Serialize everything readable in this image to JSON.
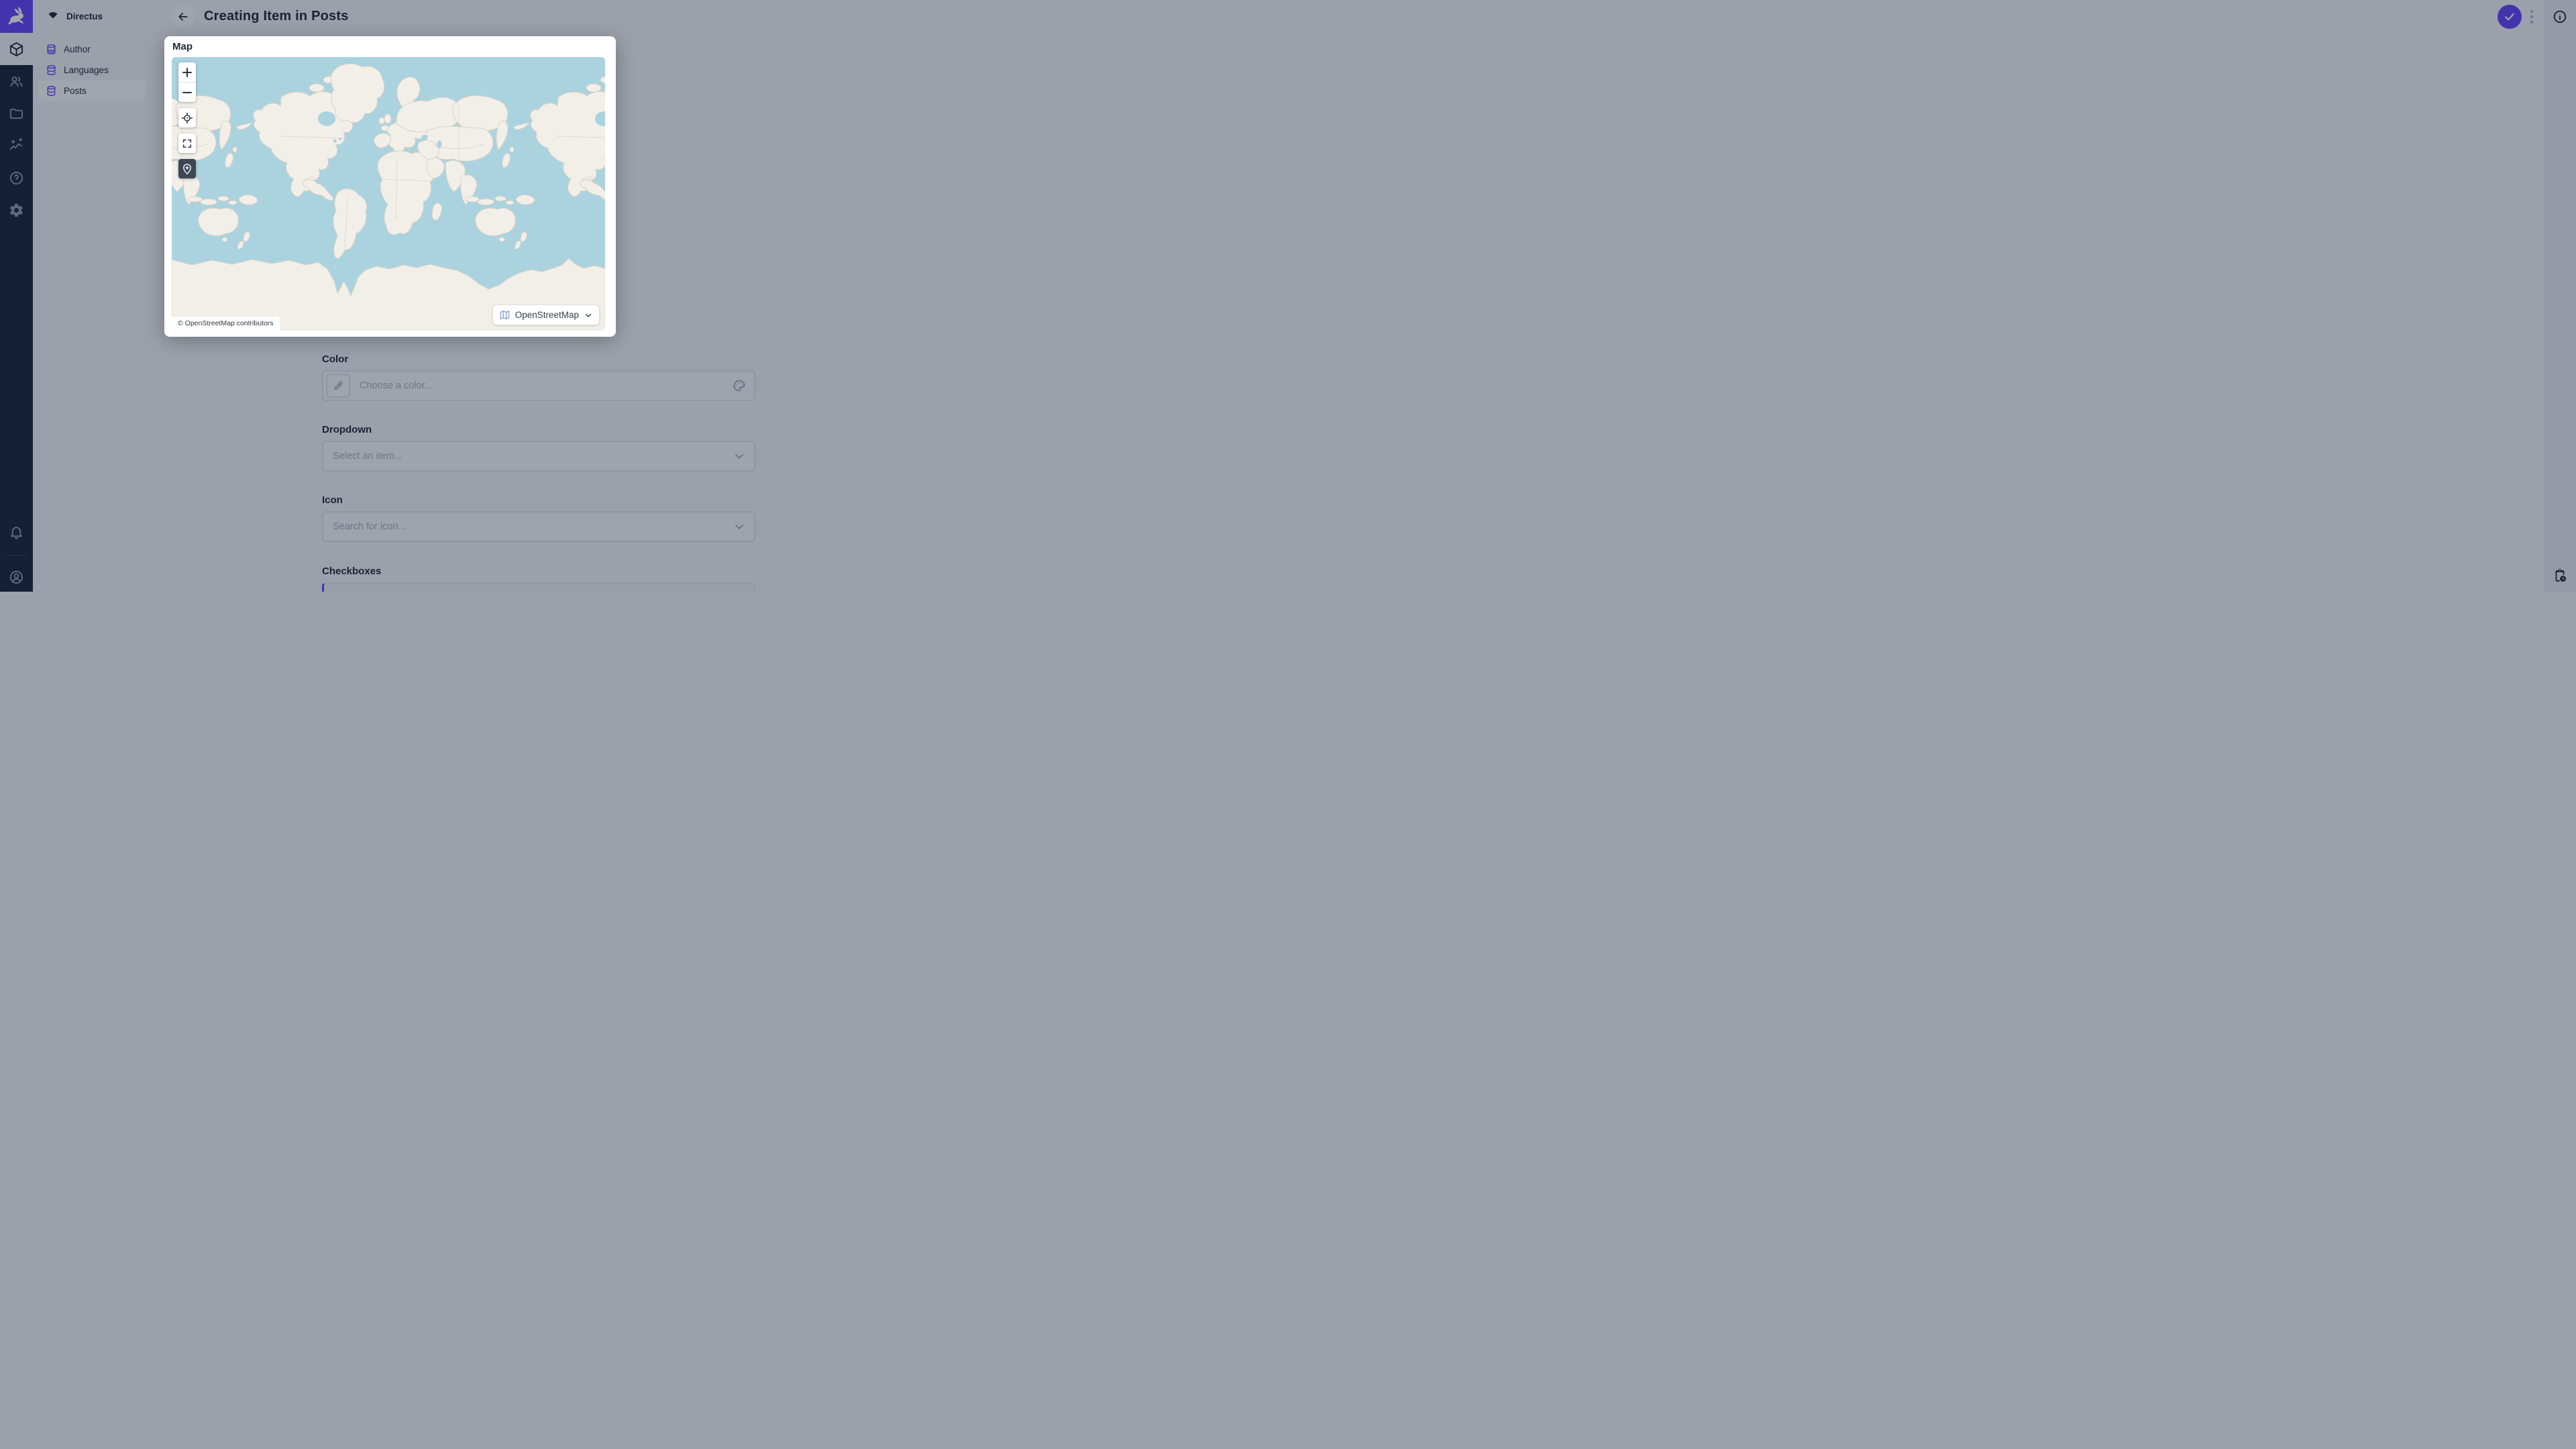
{
  "colors": {
    "accent": "#6644ff",
    "module_bar_bg": "#16263c",
    "page_bg": "#f0f4f9",
    "map_water": "#aad3df",
    "map_land": "#f2efe9",
    "marker_button_bg": "#3d4654"
  },
  "module_bar": {
    "logo_icon": "directus-rabbit",
    "items": [
      {
        "icon": "box",
        "active": true
      },
      {
        "icon": "people",
        "active": false
      },
      {
        "icon": "folder",
        "active": false
      },
      {
        "icon": "insights",
        "active": false
      },
      {
        "icon": "help",
        "active": false
      },
      {
        "icon": "settings",
        "active": false
      }
    ],
    "bottom_items": [
      {
        "icon": "bell"
      },
      {
        "icon": "account"
      }
    ]
  },
  "nav": {
    "project": "Directus",
    "items": [
      {
        "label": "Author",
        "icon": "database",
        "active": false
      },
      {
        "label": "Languages",
        "icon": "database",
        "active": false
      },
      {
        "label": "Posts",
        "icon": "database",
        "active": true
      }
    ]
  },
  "header": {
    "title": "Creating Item in Posts",
    "back_icon": "arrow-left",
    "save_icon": "check",
    "menu_icon": "dots-vertical",
    "info_icon": "info"
  },
  "right_strip": {
    "bottom_icon": "clipboard-clock"
  },
  "map_field": {
    "label": "Map",
    "controls": [
      "zoom-in",
      "zoom-out",
      "geolocate",
      "fullscreen",
      "add-marker"
    ],
    "active_control": "add-marker",
    "attribution": "© OpenStreetMap contributors",
    "basemap": {
      "icon": "map",
      "label": "OpenStreetMap"
    }
  },
  "fields": {
    "color": {
      "label": "Color",
      "placeholder": "Choose a color...",
      "left_icon": "eyedropper",
      "right_icon": "palette"
    },
    "dropdown": {
      "label": "Dropdown",
      "placeholder": "Select an item...",
      "right_icon": "chevron-down"
    },
    "icon": {
      "label": "Icon",
      "placeholder": "Search for icon...",
      "right_icon": "chevron-down"
    },
    "checkboxes": {
      "label": "Checkboxes"
    }
  }
}
